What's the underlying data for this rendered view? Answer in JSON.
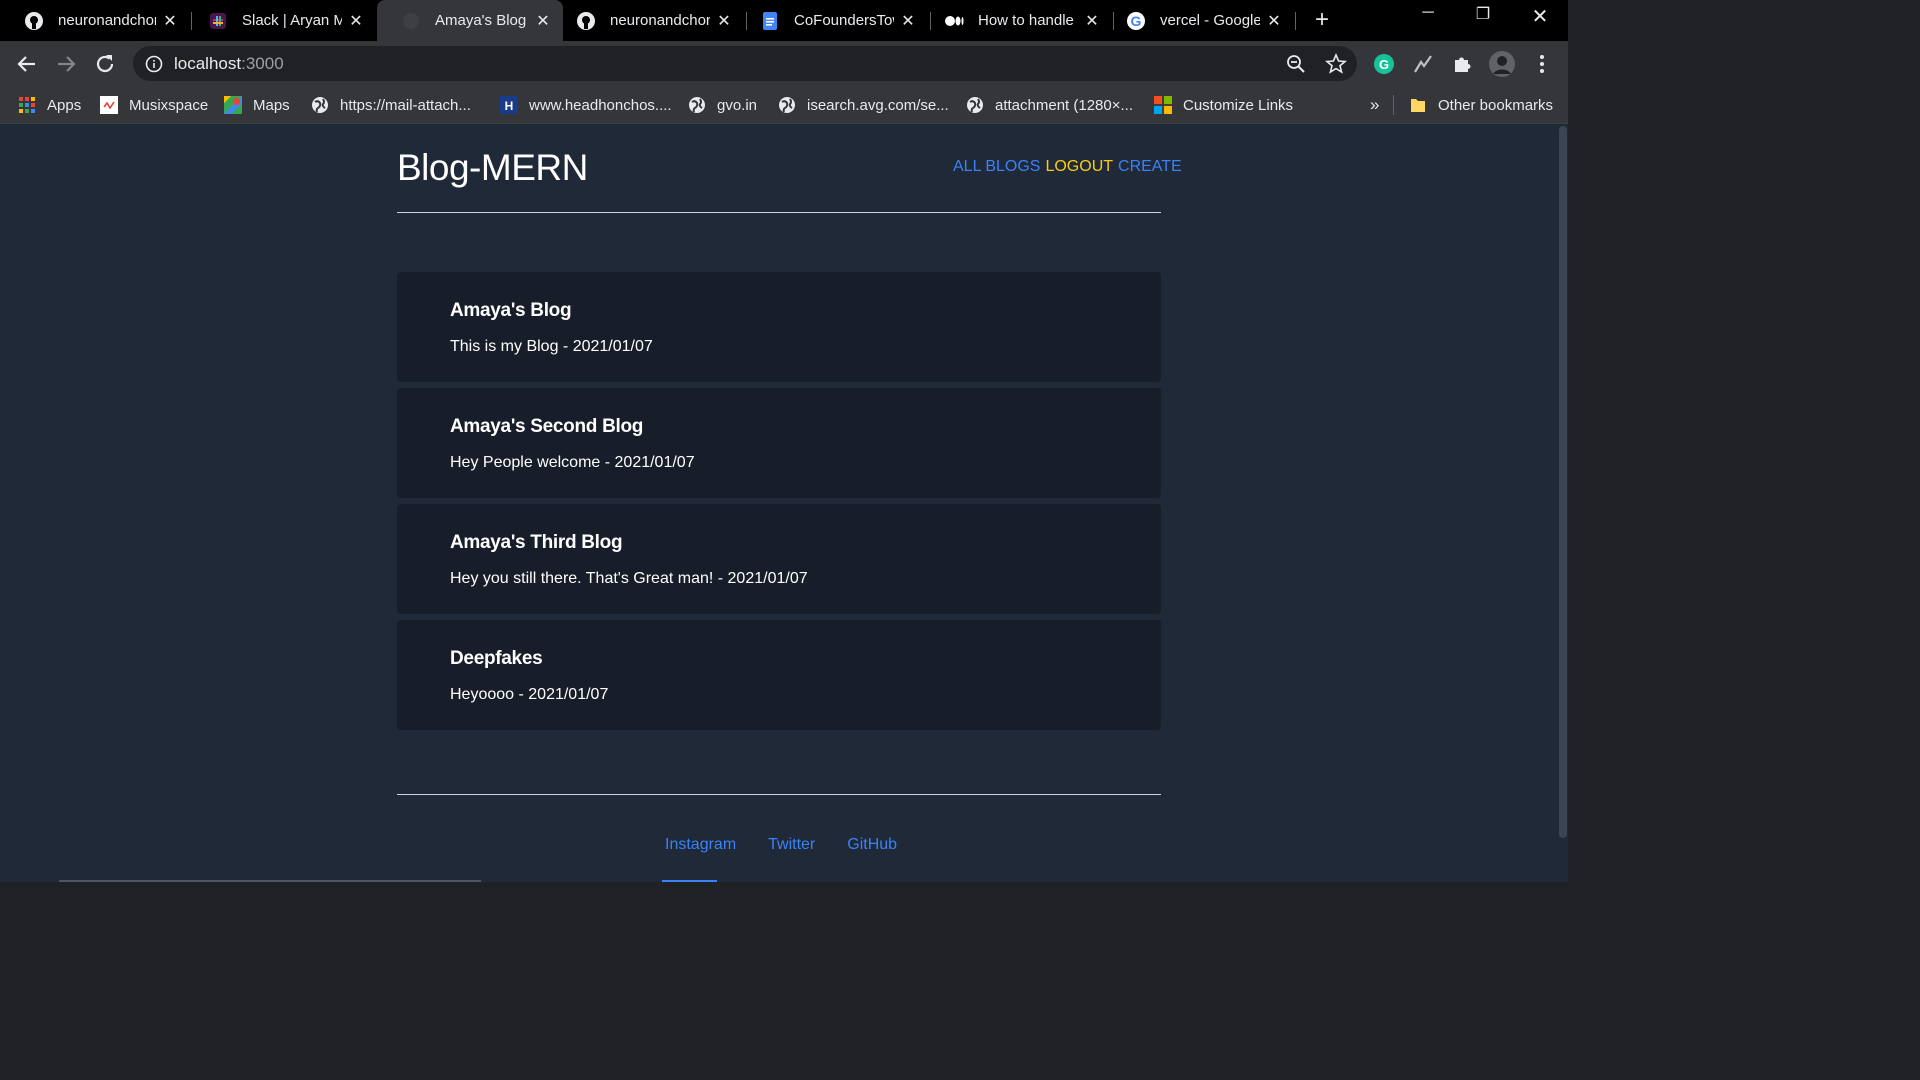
{
  "browser": {
    "tabs": [
      {
        "title": "neuronandchord",
        "icon": "github-icon"
      },
      {
        "title": "Slack | Aryan Ma",
        "icon": "slack-icon"
      },
      {
        "title": "Amaya's Blog",
        "icon": "blank-icon",
        "active": true
      },
      {
        "title": "neuronandchord",
        "icon": "github-icon"
      },
      {
        "title": "CoFoundersTow",
        "icon": "google-docs-icon"
      },
      {
        "title": "How to handle",
        "icon": "medium-icon"
      },
      {
        "title": "vercel - Google",
        "icon": "google-icon"
      }
    ],
    "address": {
      "host": "localhost",
      "path": ":3000"
    },
    "bookmarks": [
      {
        "label": "Apps",
        "icon": "apps-grid-icon"
      },
      {
        "label": "Musixspace",
        "icon": "musixspace-icon"
      },
      {
        "label": "Maps",
        "icon": "maps-icon"
      },
      {
        "label": "https://mail-attach...",
        "icon": "globe-icon"
      },
      {
        "label": "www.headhonchos....",
        "icon": "headhonchos-icon"
      },
      {
        "label": "gvo.in",
        "icon": "globe-icon"
      },
      {
        "label": "isearch.avg.com/se...",
        "icon": "globe-icon"
      },
      {
        "label": "attachment (1280×...",
        "icon": "globe-icon"
      },
      {
        "label": "Customize Links",
        "icon": "microsoft-icon"
      }
    ],
    "overflow_label": "»",
    "other_bookmarks": "Other bookmarks"
  },
  "site": {
    "title": "Blog-MERN",
    "nav": {
      "all_blogs": "ALL BLOGS",
      "logout": "LOGOUT",
      "create": "CREATE"
    },
    "blogs": [
      {
        "title": "Amaya's Blog",
        "snippet": "This is my Blog - 2021/01/07"
      },
      {
        "title": "Amaya's Second Blog",
        "snippet": "Hey People welcome - 2021/01/07"
      },
      {
        "title": "Amaya's Third Blog",
        "snippet": "Hey you still there. That's Great man! - 2021/01/07"
      },
      {
        "title": "Deepfakes",
        "snippet": "Heyoooo - 2021/01/07"
      }
    ],
    "footer": {
      "instagram": "Instagram",
      "twitter": "Twitter",
      "github": "GitHub"
    }
  },
  "colors": {
    "page_bg": "#1f2937",
    "card_bg": "#171e29",
    "link_blue": "#3b82f6",
    "logout_yellow": "#facc15"
  }
}
